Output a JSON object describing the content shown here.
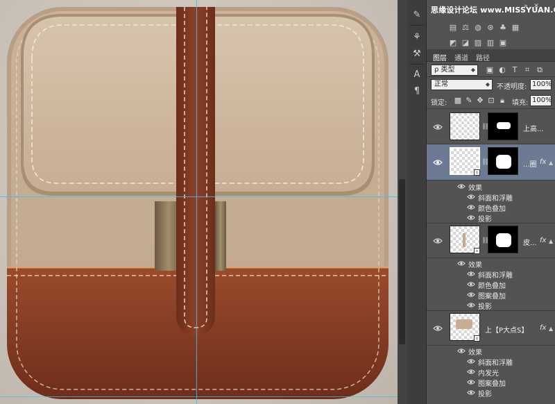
{
  "watermark": "思缘设计论坛 www.MISSYUAN.COM",
  "tool_icons": [
    "brush-presets-icon",
    "clone-source-icon",
    "tool-presets-icon",
    "character-icon",
    "paragraph-icon"
  ],
  "adjustment_icons": {
    "row1": [
      "levels-icon",
      "balance-icon",
      "photo-filter-icon",
      "channel-mixer-icon",
      "color-lookup-icon",
      "grid-icon"
    ],
    "row2": [
      "invert-icon",
      "posterize-icon",
      "threshold-icon",
      "gradient-map-icon",
      "selective-color-icon"
    ]
  },
  "layers_panel": {
    "tabs": [
      "图层",
      "通道",
      "路径"
    ],
    "filter_label": "ρ 类型",
    "blend_mode": "正常",
    "opacity_label": "不透明度:",
    "opacity_value": "100%",
    "lock_label": "锁定:",
    "fill_label": "填充:",
    "fill_value": "100%"
  },
  "layers": [
    {
      "name": "上高...",
      "selected": false,
      "has_fx": false
    },
    {
      "name": "...圈",
      "selected": true,
      "has_fx": true
    },
    {
      "name": "皮...",
      "selected": false,
      "has_fx": true
    },
    {
      "name": "上【P大点S】",
      "selected": false,
      "has_fx": true
    }
  ],
  "effects_group_label": "效果",
  "effects": {
    "layer2": [
      "斜面和浮雕",
      "颜色叠加",
      "投影"
    ],
    "layer3": [
      "斜面和浮雕",
      "颜色叠加",
      "图案叠加",
      "投影"
    ],
    "layer4": [
      "斜面和浮雕",
      "内发光",
      "图案叠加",
      "投影"
    ]
  },
  "colors": {
    "canvas_bg": "#c8c0b7",
    "canvas_fabric": "#c9b19a",
    "leather": "#8a3f25",
    "strap": "#7a3a24",
    "guide": "#38c4e8",
    "panel_bg": "#535353",
    "selected_layer": "#6c7b93"
  }
}
